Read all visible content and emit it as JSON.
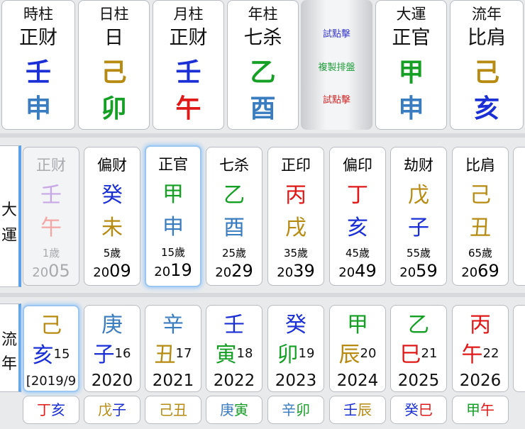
{
  "pillars": [
    {
      "label": "時柱",
      "name": "正财",
      "stem": "壬",
      "branch": "申",
      "stem_color": "#1b2fd6",
      "branch_color": "#3a7cc0"
    },
    {
      "label": "日柱",
      "name": "日",
      "stem": "己",
      "branch": "卯",
      "stem_color": "#b78a12",
      "branch_color": "#15a025"
    },
    {
      "label": "月柱",
      "name": "正财",
      "stem": "壬",
      "branch": "午",
      "stem_color": "#1b2fd6",
      "branch_color": "#e01818"
    },
    {
      "label": "年柱",
      "name": "七杀",
      "stem": "乙",
      "branch": "酉",
      "stem_color": "#15a025",
      "branch_color": "#3a7cc0"
    },
    {
      "label": "大運",
      "name": "正官",
      "stem": "甲",
      "branch": "申",
      "stem_color": "#15a025",
      "branch_color": "#3a7cc0"
    },
    {
      "label": "流年",
      "name": "比肩",
      "stem": "己",
      "branch": "亥",
      "stem_color": "#b78a12",
      "branch_color": "#1b2fd6"
    }
  ],
  "middle": {
    "btn1": "試點擊",
    "btn2": "複製排盤",
    "btn3": "試點擊"
  },
  "dayun_label": "大運",
  "liunian_label": "流年",
  "dayun": [
    {
      "god": "正财",
      "stem": "壬",
      "branch": "午",
      "age": "1歲",
      "yr_a": "20",
      "yr_b": "05",
      "stem_color": "#1b2fd6",
      "branch_color": "#e01818"
    },
    {
      "god": "偏财",
      "stem": "癸",
      "branch": "未",
      "age": "5歲",
      "yr_a": "20",
      "yr_b": "09",
      "stem_color": "#1b2fd6",
      "branch_color": "#b78a12"
    },
    {
      "god": "正官",
      "stem": "甲",
      "branch": "申",
      "age": "15歲",
      "yr_a": "20",
      "yr_b": "19",
      "stem_color": "#15a025",
      "branch_color": "#3a7cc0"
    },
    {
      "god": "七杀",
      "stem": "乙",
      "branch": "酉",
      "age": "25歲",
      "yr_a": "20",
      "yr_b": "29",
      "stem_color": "#15a025",
      "branch_color": "#3a7cc0"
    },
    {
      "god": "正印",
      "stem": "丙",
      "branch": "戌",
      "age": "35歲",
      "yr_a": "20",
      "yr_b": "39",
      "stem_color": "#e01818",
      "branch_color": "#b78a12"
    },
    {
      "god": "偏印",
      "stem": "丁",
      "branch": "亥",
      "age": "45歲",
      "yr_a": "20",
      "yr_b": "49",
      "stem_color": "#e01818",
      "branch_color": "#1b2fd6"
    },
    {
      "god": "劫财",
      "stem": "戊",
      "branch": "子",
      "age": "55歲",
      "yr_a": "20",
      "yr_b": "59",
      "stem_color": "#b78a12",
      "branch_color": "#1b2fd6"
    },
    {
      "god": "比肩",
      "stem": "己",
      "branch": "丑",
      "age": "65歲",
      "yr_a": "20",
      "yr_b": "69",
      "stem_color": "#b78a12",
      "branch_color": "#b78a12"
    }
  ],
  "liunian": [
    {
      "stem": "己",
      "branch": "亥",
      "num": "15",
      "year": "[2019/9",
      "stem_color": "#b78a12",
      "branch_color": "#1b2fd6"
    },
    {
      "stem": "庚",
      "branch": "子",
      "num": "16",
      "year": "2020",
      "stem_color": "#3a7cc0",
      "branch_color": "#1b2fd6"
    },
    {
      "stem": "辛",
      "branch": "丑",
      "num": "17",
      "year": "2021",
      "stem_color": "#3a7cc0",
      "branch_color": "#b78a12"
    },
    {
      "stem": "壬",
      "branch": "寅",
      "num": "18",
      "year": "2022",
      "stem_color": "#1b2fd6",
      "branch_color": "#15a025"
    },
    {
      "stem": "癸",
      "branch": "卯",
      "num": "19",
      "year": "2023",
      "stem_color": "#1b2fd6",
      "branch_color": "#15a025"
    },
    {
      "stem": "甲",
      "branch": "辰",
      "num": "20",
      "year": "2024",
      "stem_color": "#15a025",
      "branch_color": "#b78a12"
    },
    {
      "stem": "乙",
      "branch": "巳",
      "num": "21",
      "year": "2025",
      "stem_color": "#15a025",
      "branch_color": "#e01818"
    },
    {
      "stem": "丙",
      "branch": "午",
      "num": "22",
      "year": "2026",
      "stem_color": "#e01818",
      "branch_color": "#e01818"
    }
  ],
  "ganzhi_row": [
    {
      "stem": "丁",
      "branch": "亥",
      "stem_color": "#e01818",
      "branch_color": "#1b2fd6"
    },
    {
      "stem": "戊",
      "branch": "子",
      "stem_color": "#b78a12",
      "branch_color": "#1b2fd6"
    },
    {
      "stem": "己",
      "branch": "丑",
      "stem_color": "#b78a12",
      "branch_color": "#b78a12"
    },
    {
      "stem": "庚",
      "branch": "寅",
      "stem_color": "#3a7cc0",
      "branch_color": "#15a025"
    },
    {
      "stem": "辛",
      "branch": "卯",
      "stem_color": "#3a7cc0",
      "branch_color": "#15a025"
    },
    {
      "stem": "壬",
      "branch": "辰",
      "stem_color": "#1b2fd6",
      "branch_color": "#b78a12"
    },
    {
      "stem": "癸",
      "branch": "巳",
      "stem_color": "#1b2fd6",
      "branch_color": "#e01818"
    },
    {
      "stem": "甲",
      "branch": "午",
      "stem_color": "#15a025",
      "branch_color": "#e01818"
    }
  ],
  "colors": {
    "blue": "#1b2fd6",
    "steel": "#3a7cc0",
    "gold": "#b78a12",
    "green": "#15a025",
    "red": "#e01818",
    "selection": "#9cc6f2"
  }
}
